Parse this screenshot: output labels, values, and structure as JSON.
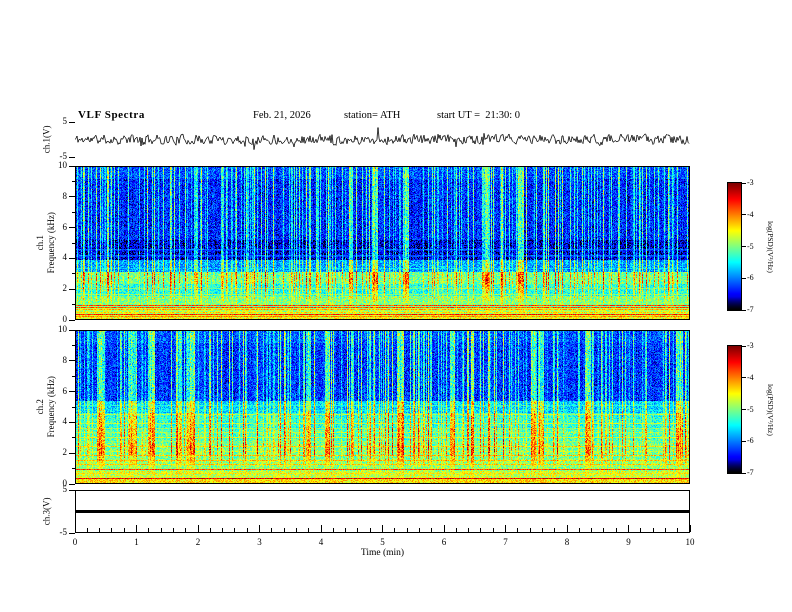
{
  "header": {
    "title": "VLF Spectra",
    "date": "Feb. 21, 2026",
    "station": "station= ATH",
    "start_ut": "start UT =  21:30: 0"
  },
  "xaxis": {
    "label": "Time  (min)",
    "min": 0,
    "max": 10,
    "ticks": [
      "0",
      "1",
      "2",
      "3",
      "4",
      "5",
      "6",
      "7",
      "8",
      "9",
      "10"
    ]
  },
  "panels": {
    "ch1_wave": {
      "ylabel": "ch.1(V)",
      "ymin": -5,
      "ymax": 5,
      "yticks": [
        {
          "v": 5,
          "label": "5"
        },
        {
          "v": -5,
          "label": "-5"
        }
      ]
    },
    "ch1_spec": {
      "ylabel1": "ch.1",
      "ylabel2": "Frequency  (kHz)",
      "ymin": 0,
      "ymax": 10,
      "yticks": [
        {
          "v": 10,
          "label": "10"
        },
        {
          "v": 8,
          "label": "8"
        },
        {
          "v": 6,
          "label": "6"
        },
        {
          "v": 4,
          "label": "4"
        },
        {
          "v": 2,
          "label": "2"
        },
        {
          "v": 0,
          "label": "0"
        }
      ]
    },
    "ch2_spec": {
      "ylabel1": "ch.2",
      "ylabel2": "Frequency  (kHz)",
      "ymin": 0,
      "ymax": 10,
      "yticks": [
        {
          "v": 10,
          "label": "10"
        },
        {
          "v": 8,
          "label": "8"
        },
        {
          "v": 6,
          "label": "6"
        },
        {
          "v": 4,
          "label": "4"
        },
        {
          "v": 2,
          "label": "2"
        },
        {
          "v": 0,
          "label": "0"
        }
      ]
    },
    "ch3_wave": {
      "ylabel": "ch.3(V)",
      "ymin": -5,
      "ymax": 5,
      "yticks": [
        {
          "v": 5,
          "label": "5"
        },
        {
          "v": -5,
          "label": "-5"
        }
      ]
    }
  },
  "colorbar": {
    "label": "log(PSD)(V²/Hz)",
    "min": -7,
    "max": -3,
    "ticks": [
      {
        "v": -3,
        "label": "-3"
      },
      {
        "v": -4,
        "label": "-4"
      },
      {
        "v": -5,
        "label": "-5"
      },
      {
        "v": -6,
        "label": "-6"
      },
      {
        "v": -7,
        "label": "-7"
      }
    ]
  },
  "chart_data": {
    "type": "heatmap",
    "title": "VLF Spectra",
    "date": "Feb. 21, 2026",
    "station": "ATH",
    "start_ut": "21:30:0",
    "x": {
      "label": "Time (min)",
      "min": 0,
      "max": 10,
      "unit": "min"
    },
    "colorbar": {
      "label": "log(PSD)(V²/Hz)",
      "min": -7,
      "max": -3
    },
    "colormap": "jet with black base",
    "waveform_ch1": {
      "kind": "line",
      "ylabel": "ch.1(V)",
      "ylim": [
        -5,
        5
      ],
      "mean_V": 0,
      "typical_amplitude_V": 1.5,
      "seed": 11
    },
    "spectrogram_ch1": {
      "ylabel": "Frequency (kHz)",
      "ylim_kHz": [
        0,
        10
      ],
      "seed": 21,
      "streak_density": 0.3,
      "bands": [
        [
          0,
          0.3,
          0.62
        ],
        [
          0.3,
          0.7,
          0.55
        ],
        [
          0.7,
          1.5,
          0.48
        ],
        [
          1.5,
          2.3,
          0.38
        ],
        [
          2.3,
          3.1,
          0.45
        ],
        [
          3.1,
          3.9,
          0.25
        ],
        [
          3.9,
          5.2,
          0.07
        ],
        [
          5.2,
          9.2,
          0.13
        ],
        [
          9.2,
          10,
          0.17
        ]
      ],
      "harmonic_lines": [
        [
          0.15,
          0.8
        ],
        [
          0.3,
          0.85
        ],
        [
          0.45,
          0.8
        ],
        [
          0.6,
          0.9
        ],
        [
          0.75,
          0.8
        ],
        [
          0.9,
          0.85
        ],
        [
          1.05,
          0.7
        ],
        [
          1.25,
          0.65
        ],
        [
          1.6,
          0.55
        ],
        [
          2.0,
          0.5
        ],
        [
          2.7,
          0.6
        ],
        [
          3.3,
          0.4
        ],
        [
          4.15,
          0.3
        ],
        [
          4.55,
          0.28
        ]
      ]
    },
    "spectrogram_ch2": {
      "ylabel": "Frequency (kHz)",
      "ylim_kHz": [
        0,
        10
      ],
      "seed": 77,
      "streak_density": 0.3,
      "bands": [
        [
          0,
          0.3,
          0.65
        ],
        [
          0.3,
          0.8,
          0.57
        ],
        [
          0.8,
          1.6,
          0.5
        ],
        [
          1.6,
          2.6,
          0.46
        ],
        [
          2.6,
          3.6,
          0.42
        ],
        [
          3.6,
          4.6,
          0.38
        ],
        [
          4.6,
          5.4,
          0.3
        ],
        [
          5.4,
          9.2,
          0.14
        ],
        [
          9.2,
          10,
          0.17
        ]
      ],
      "harmonic_lines": [
        [
          0.3,
          0.9
        ],
        [
          0.6,
          0.8
        ],
        [
          0.9,
          0.85
        ],
        [
          1.2,
          0.75
        ],
        [
          1.5,
          0.8
        ],
        [
          1.8,
          0.7
        ],
        [
          2.1,
          0.75
        ],
        [
          2.4,
          0.65
        ],
        [
          2.7,
          0.7
        ],
        [
          3.0,
          0.6
        ],
        [
          3.3,
          0.65
        ],
        [
          3.6,
          0.55
        ],
        [
          3.9,
          0.6
        ],
        [
          4.2,
          0.5
        ],
        [
          4.5,
          0.55
        ],
        [
          4.8,
          0.45
        ],
        [
          5.1,
          0.4
        ]
      ]
    },
    "waveform_ch3": {
      "kind": "line",
      "ylabel": "ch.3(V)",
      "ylim": [
        -5,
        5
      ],
      "constant_V": 0
    }
  }
}
